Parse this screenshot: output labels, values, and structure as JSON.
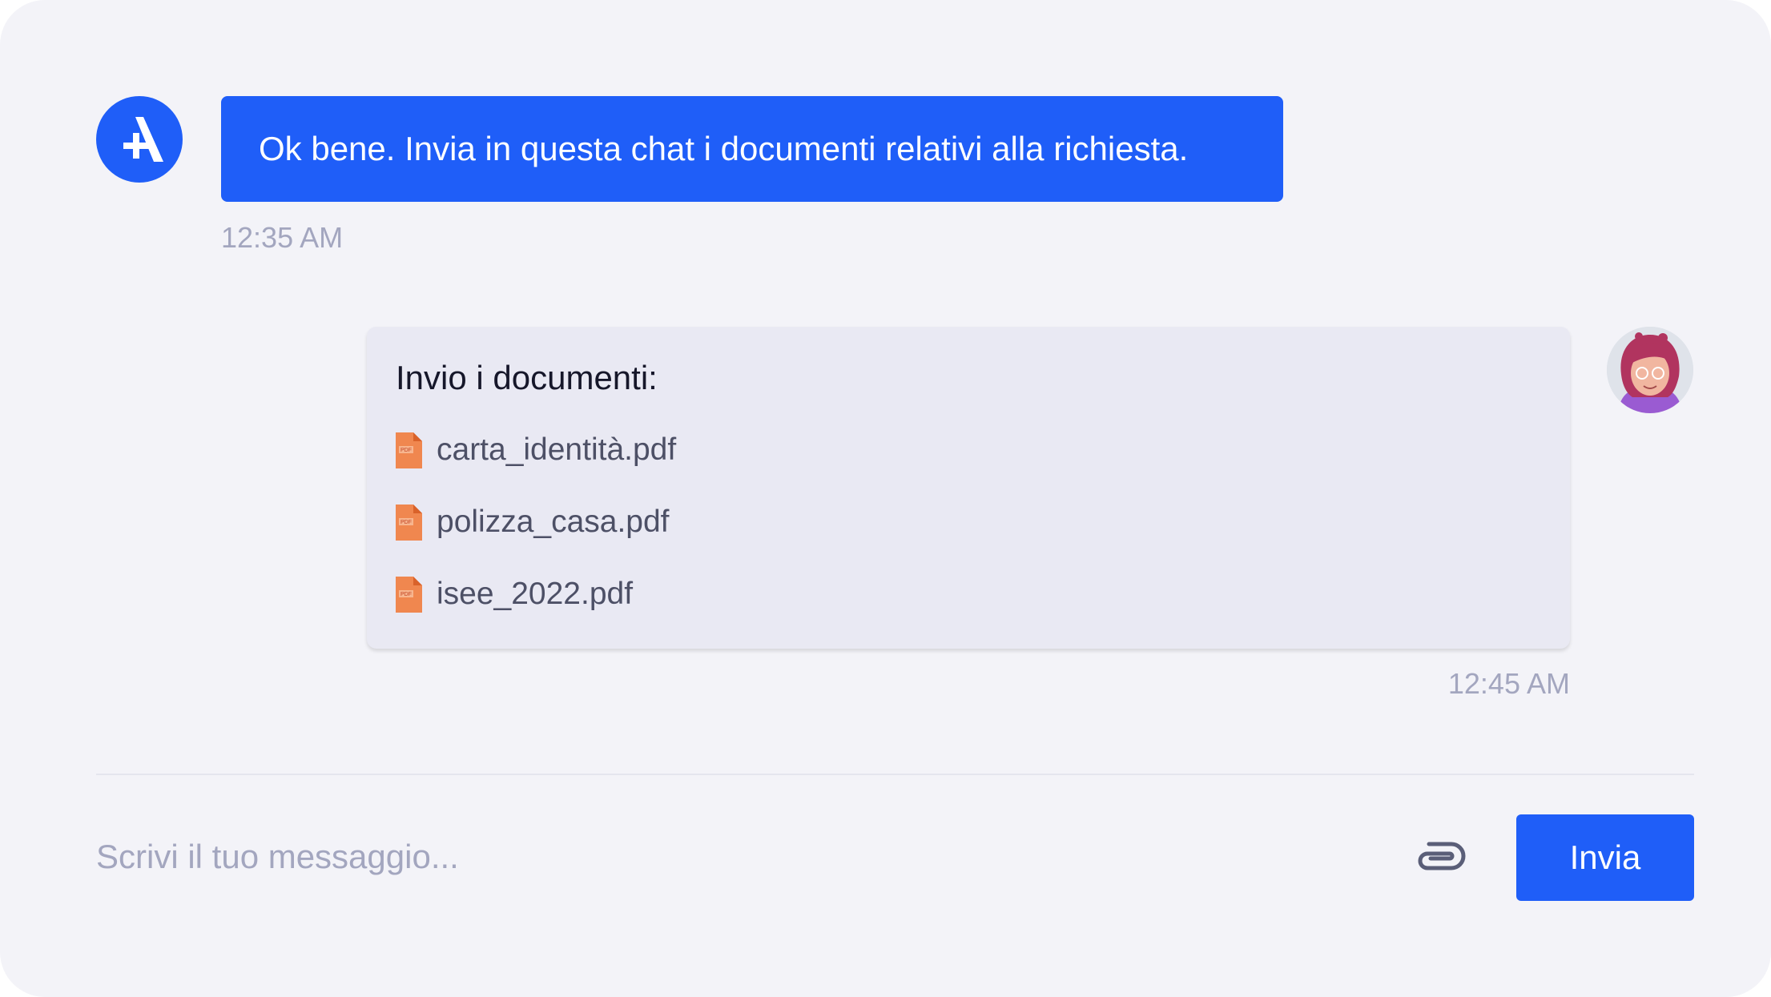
{
  "colors": {
    "accent": "#1f5ef8",
    "pdf_icon": "#f0874f"
  },
  "bot": {
    "avatar_icon": "logo-icon",
    "message": "Ok bene. Invia in questa chat i documenti relativi alla richiesta.",
    "time": "12:35 AM"
  },
  "user": {
    "avatar": "user-avatar",
    "title": "Invio i documenti:",
    "documents": [
      {
        "name": "carta_identità.pdf",
        "icon": "pdf-icon"
      },
      {
        "name": "polizza_casa.pdf",
        "icon": "pdf-icon"
      },
      {
        "name": "isee_2022.pdf",
        "icon": "pdf-icon"
      }
    ],
    "time": "12:45 AM"
  },
  "composer": {
    "placeholder": "Scrivi il tuo messaggio...",
    "value": "",
    "attach_icon": "paperclip-icon",
    "send_label": "Invia"
  }
}
